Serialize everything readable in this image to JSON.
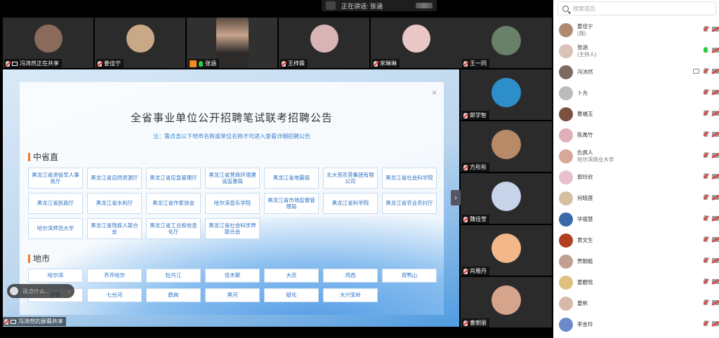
{
  "speaking": {
    "label": "正在讲话:",
    "name": "张涵"
  },
  "strip": [
    {
      "name": "冯沛然正在共享",
      "screen": true,
      "color": "#8a6a5a"
    },
    {
      "name": "姜佳宁",
      "color": "#c9a888"
    },
    {
      "name": "张涵",
      "self": true
    },
    {
      "name": "王梓霖",
      "color": "#d8b4b4"
    },
    {
      "name": "宋琳琳",
      "color": "#e9c7c7"
    }
  ],
  "right_tiles": [
    {
      "name": "王一同",
      "color": "#6a8068"
    },
    {
      "name": "郎学智",
      "color": "#2d8ec9"
    },
    {
      "name": "方彤彤",
      "color": "#b88a68"
    },
    {
      "name": "魏佳莹",
      "color": "#c7d3e9"
    },
    {
      "name": "肖雅丹",
      "color": "#f3b889"
    },
    {
      "name": "曹朝丽",
      "color": "#d5a48a"
    }
  ],
  "share": {
    "title": "全省事业单位公开招聘笔试联考招聘公告",
    "note": "注：需点击以下地市名称或单位名称才可进入查看详细招聘公告",
    "close": "×",
    "sec1": "中省直",
    "units": [
      "黑龙江省退役军人事务厅",
      "黑龙江省自然资源厅",
      "黑龙江省应急管理厅",
      "黑龙江省营商环境建设监督局",
      "黑龙江省地震局",
      "北大荒农垦集团有限公司",
      "黑龙江省社会科学院",
      "黑龙江省民政厅",
      "黑龙江省水利厅",
      "黑龙江省作家协会",
      "哈尔滨音乐学院",
      "黑龙江省市场监督管理局",
      "黑龙江省科学院",
      "黑龙江省农业农村厅",
      "哈尔滨师范大学",
      "黑龙江省残疾人联合会",
      "黑龙江省工业和信息化厅",
      "黑龙江省社会科学界联合会"
    ],
    "sec2": "地市",
    "cities": [
      "哈尔滨",
      "齐齐哈尔",
      "牡丹江",
      "佳木斯",
      "大庆",
      "鸡西",
      "双鸭山",
      "伊春",
      "七台河",
      "鹤岗",
      "黑河",
      "绥化",
      "大兴安岭"
    ],
    "share_label": "冯沛然的屏幕共享",
    "chat_placeholder": "说点什么...",
    "next": "›",
    "chat_arrow": "‹"
  },
  "members": {
    "search_placeholder": "搜索成员",
    "list": [
      {
        "name": "姜佳宁",
        "sub": "(我)",
        "color": "#b08a70",
        "mic": "off",
        "cam": "off"
      },
      {
        "name": "张涵",
        "sub": "(主持人)",
        "color": "#d9c3b6",
        "mic": "green",
        "cam": "off"
      },
      {
        "name": "冯沛然",
        "color": "#7a6a60",
        "screen": true,
        "mic": "off",
        "cam": "off"
      },
      {
        "name": "卜允",
        "color": "#bbb",
        "mic": "off",
        "cam": "off"
      },
      {
        "name": "曹福玉",
        "color": "#7a5040",
        "mic": "off",
        "cam": "off"
      },
      {
        "name": "陈禹竹",
        "color": "#e0b0b8",
        "mic": "off",
        "cam": "off"
      },
      {
        "name": "仇佩人",
        "sub": "哈尔滨商业大学",
        "color": "#d6a89a",
        "mic": "off",
        "cam": "off"
      },
      {
        "name": "郭玲欣",
        "color": "#e9c0d0",
        "mic": "off",
        "cam": "off"
      },
      {
        "name": "何晓莲",
        "color": "#d4c0a0",
        "mic": "off",
        "cam": "off"
      },
      {
        "name": "华德慧",
        "color": "#3a6aa8",
        "mic": "off",
        "cam": "off"
      },
      {
        "name": "黄文生",
        "color": "#b04020",
        "mic": "off",
        "cam": "off"
      },
      {
        "name": "贾朝懿",
        "color": "#c0a090",
        "mic": "off",
        "cam": "off"
      },
      {
        "name": "姜碧晗",
        "color": "#e0c080",
        "mic": "off",
        "cam": "off"
      },
      {
        "name": "姜帆",
        "color": "#d8b8a8",
        "mic": "off",
        "cam": "off"
      },
      {
        "name": "李金玲",
        "color": "#6a8ac8",
        "mic": "off",
        "cam": "off"
      }
    ]
  }
}
